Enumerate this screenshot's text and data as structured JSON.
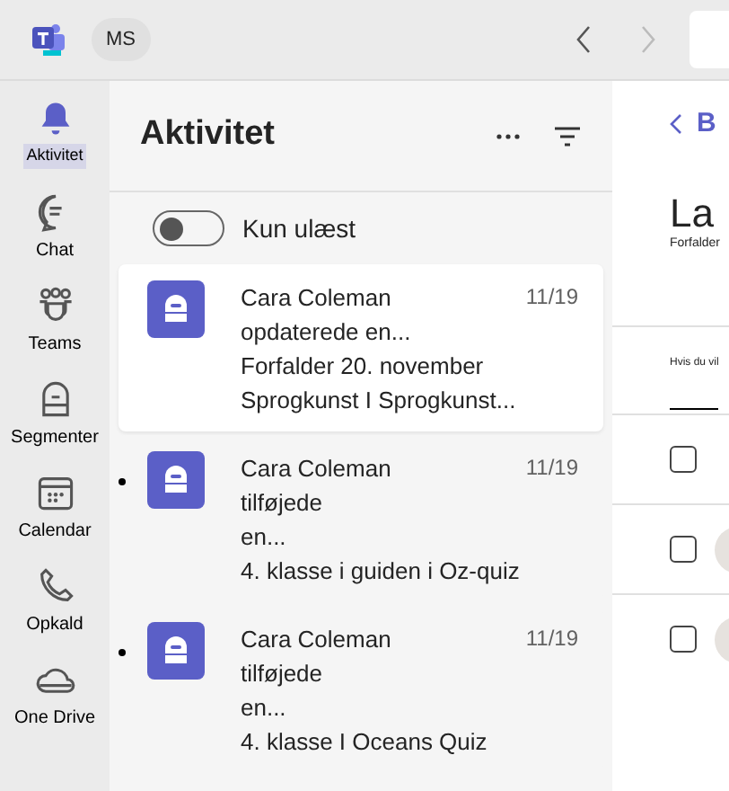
{
  "top_bar": {
    "account_badge": "MS"
  },
  "rail": [
    {
      "label": "Aktivitet",
      "selected": true
    },
    {
      "label": "Chat",
      "selected": false
    },
    {
      "label": "Teams",
      "selected": false
    },
    {
      "label": "Segmenter",
      "selected": false
    },
    {
      "label": "Calendar",
      "selected": false
    },
    {
      "label": "Opkald",
      "selected": false
    },
    {
      "label": "One Drive",
      "selected": false
    }
  ],
  "activity": {
    "title": "Aktivitet",
    "toggle": {
      "label": "Kun ulæst",
      "on": false
    },
    "feed": [
      {
        "name": "Cara Coleman",
        "time": "11/19",
        "lines": [
          "opdaterede en...",
          "Forfalder 20. november",
          "Sprogkunst I Sprogkunst..."
        ],
        "selected": true,
        "unread": false
      },
      {
        "name": "Cara Coleman",
        "time": "11/19",
        "lines": [
          "tilføjede",
          "en...",
          "4. klasse i guiden i Oz-quiz"
        ],
        "selected": false,
        "unread": true
      },
      {
        "name": "Cara Coleman",
        "time": "11/19",
        "lines": [
          "tilføjede",
          "en...",
          "4. klasse I Oceans Quiz"
        ],
        "selected": false,
        "unread": true
      }
    ]
  },
  "detail": {
    "back_label": "B",
    "title": "La",
    "subtitle": "Forfalder",
    "column_label": "Hvis du vil",
    "rows": [
      {
        "checked": false,
        "avatar": false
      },
      {
        "checked": false,
        "avatar": true
      },
      {
        "checked": false,
        "avatar": true
      }
    ]
  }
}
